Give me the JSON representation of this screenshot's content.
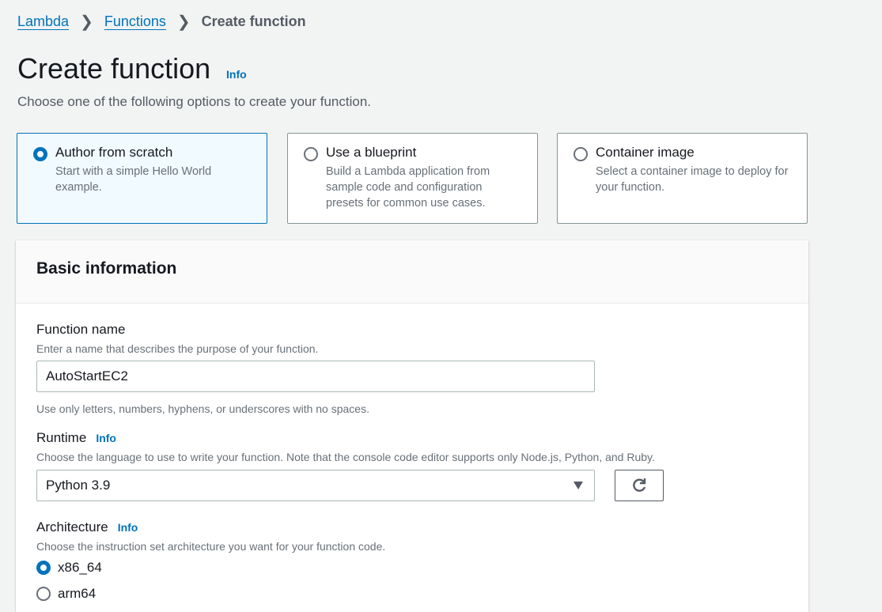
{
  "breadcrumb": {
    "items": [
      "Lambda",
      "Functions"
    ],
    "current": "Create function"
  },
  "page": {
    "title": "Create function",
    "info": "Info",
    "subtitle": "Choose one of the following options to create your function."
  },
  "options": [
    {
      "title": "Author from scratch",
      "desc": "Start with a simple Hello World example.",
      "selected": true
    },
    {
      "title": "Use a blueprint",
      "desc": "Build a Lambda application from sample code and configuration presets for common use cases.",
      "selected": false
    },
    {
      "title": "Container image",
      "desc": "Select a container image to deploy for your function.",
      "selected": false
    }
  ],
  "basic": {
    "header": "Basic information",
    "function_name": {
      "label": "Function name",
      "desc": "Enter a name that describes the purpose of your function.",
      "value": "AutoStartEC2",
      "hint": "Use only letters, numbers, hyphens, or underscores with no spaces."
    },
    "runtime": {
      "label": "Runtime",
      "info": "Info",
      "desc": "Choose the language to use to write your function. Note that the console code editor supports only Node.js, Python, and Ruby.",
      "value": "Python 3.9"
    },
    "architecture": {
      "label": "Architecture",
      "info": "Info",
      "desc": "Choose the instruction set architecture you want for your function code.",
      "options": [
        {
          "label": "x86_64",
          "selected": true
        },
        {
          "label": "arm64",
          "selected": false
        }
      ]
    }
  }
}
